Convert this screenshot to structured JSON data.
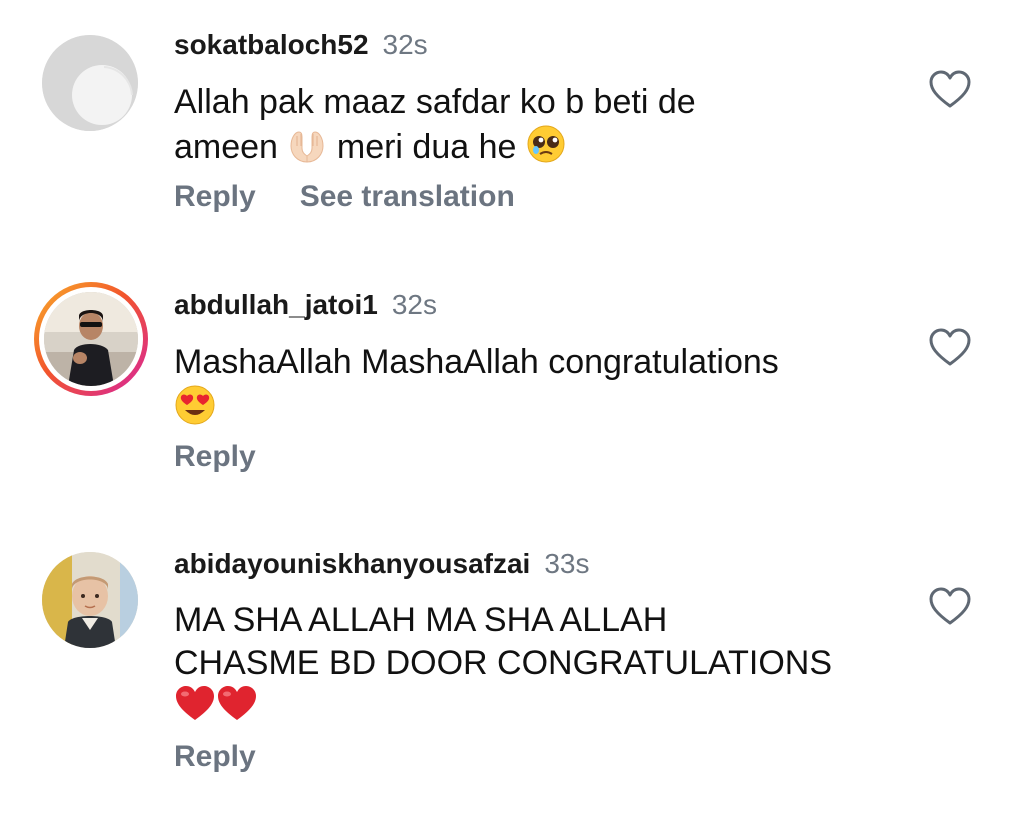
{
  "comments": [
    {
      "username": "sokatbaloch52",
      "time": "32s",
      "text_line1": "Allah pak maaz safdar ko b beti de",
      "text_line2_a": "ameen",
      "text_line2_b": "meri dua he",
      "reply_label": "Reply",
      "translate_label": "See translation",
      "avatar": "default-avatar",
      "emojis": [
        "praying-hands",
        "pleading-face"
      ]
    },
    {
      "username": "abdullah_jatoi1",
      "time": "32s",
      "text_line1": "MashaAllah MashaAllah congratulations",
      "reply_label": "Reply",
      "avatar": "story-ring-avatar",
      "emojis": [
        "heart-eyes-face"
      ]
    },
    {
      "username": "abidayouniskhanyousafzai",
      "time": "33s",
      "text_line1": "MA SHA ALLAH MA SHA ALLAH",
      "text_line2": "CHASME BD DOOR CONGRATULATIONS",
      "reply_label": "Reply",
      "avatar": "baby-photo-avatar",
      "emojis": [
        "red-heart",
        "red-heart"
      ]
    }
  ],
  "colors": {
    "meta_gray": "#6e7782",
    "action_gray": "#6b7480",
    "story_ring_start": "#f8b02a",
    "story_ring_end": "#d6249f",
    "heart_red": "#e0242f"
  }
}
